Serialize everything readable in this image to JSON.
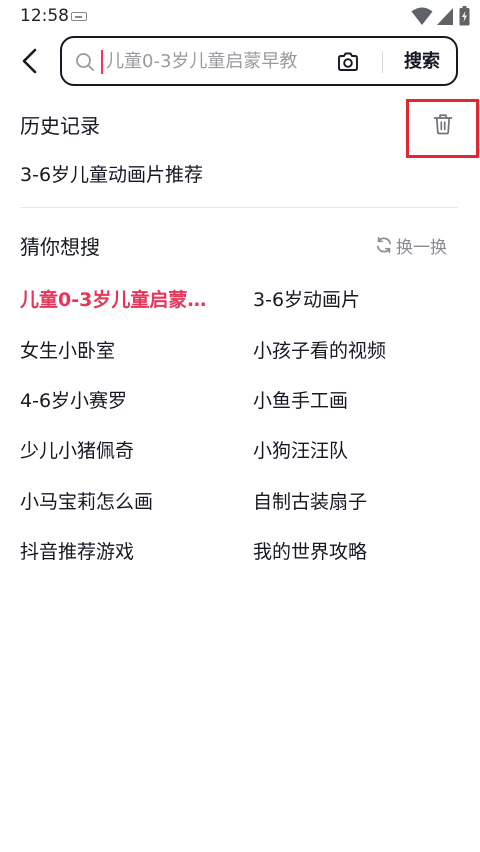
{
  "status_bar": {
    "time": "12:58",
    "icons": [
      "keyboard-icon",
      "wifi-icon",
      "signal-icon",
      "battery-icon"
    ]
  },
  "search": {
    "value": "儿童0-3岁儿童启蒙早教",
    "submit_label": "搜索",
    "icons": [
      "back-arrow-icon",
      "search-icon",
      "camera-icon"
    ]
  },
  "history": {
    "title": "历史记录",
    "clear_icon": "trash-icon",
    "items": [
      "3-6岁儿童动画片推荐"
    ]
  },
  "guess": {
    "title": "猜你想搜",
    "refresh_label": "换一换",
    "refresh_icon": "refresh-icon",
    "items": [
      "儿童0-3岁儿童启蒙…",
      "3-6岁动画片",
      "女生小卧室",
      "小孩子看的视频",
      "4-6岁小赛罗",
      "小鱼手工画",
      "少儿小猪佩奇",
      "小狗汪汪队",
      "小马宝莉怎么画",
      "自制古装扇子",
      "抖音推荐游戏",
      "我的世界攻略"
    ]
  },
  "colors": {
    "accent": "#fe2c55",
    "hot_text": "#e8365b",
    "highlight_box": "#e0262f",
    "primary_text": "#161823",
    "secondary_text": "#8a8b91"
  }
}
